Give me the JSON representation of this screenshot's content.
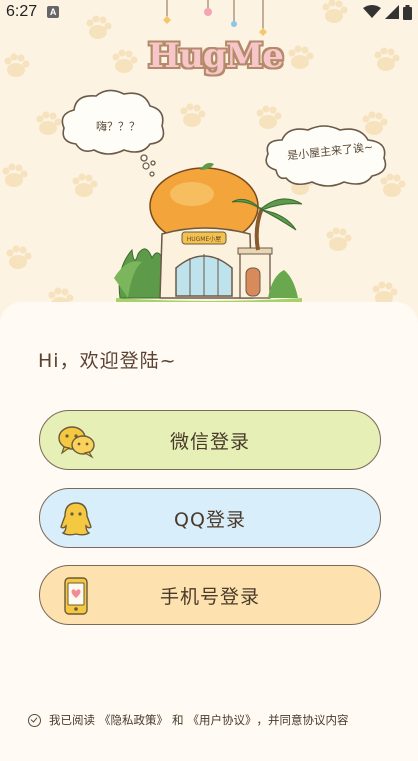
{
  "status_bar": {
    "time": "6:27",
    "notification_icon": "A",
    "icons": [
      "wifi-icon",
      "signal-icon",
      "battery-icon"
    ]
  },
  "hero": {
    "logo": "HugMe",
    "cloud_left_text": "嗨？？？",
    "cloud_right_text": "是小屋主来了诶~",
    "house_sign": "HUGME小屋"
  },
  "login": {
    "greeting": "Hi，欢迎登陆~",
    "buttons": [
      {
        "label": "微信登录",
        "icon": "wechat-icon",
        "color": "#e5efb6"
      },
      {
        "label": "QQ登录",
        "icon": "qq-icon",
        "color": "#d9eefb"
      },
      {
        "label": "手机号登录",
        "icon": "phone-icon",
        "color": "#fde2b0"
      }
    ]
  },
  "agreement": {
    "prefix": "我已阅读",
    "privacy_link": "《隐私政策》",
    "and": "和",
    "user_link": "《用户协议》",
    "suffix": "，并同意协议内容"
  }
}
